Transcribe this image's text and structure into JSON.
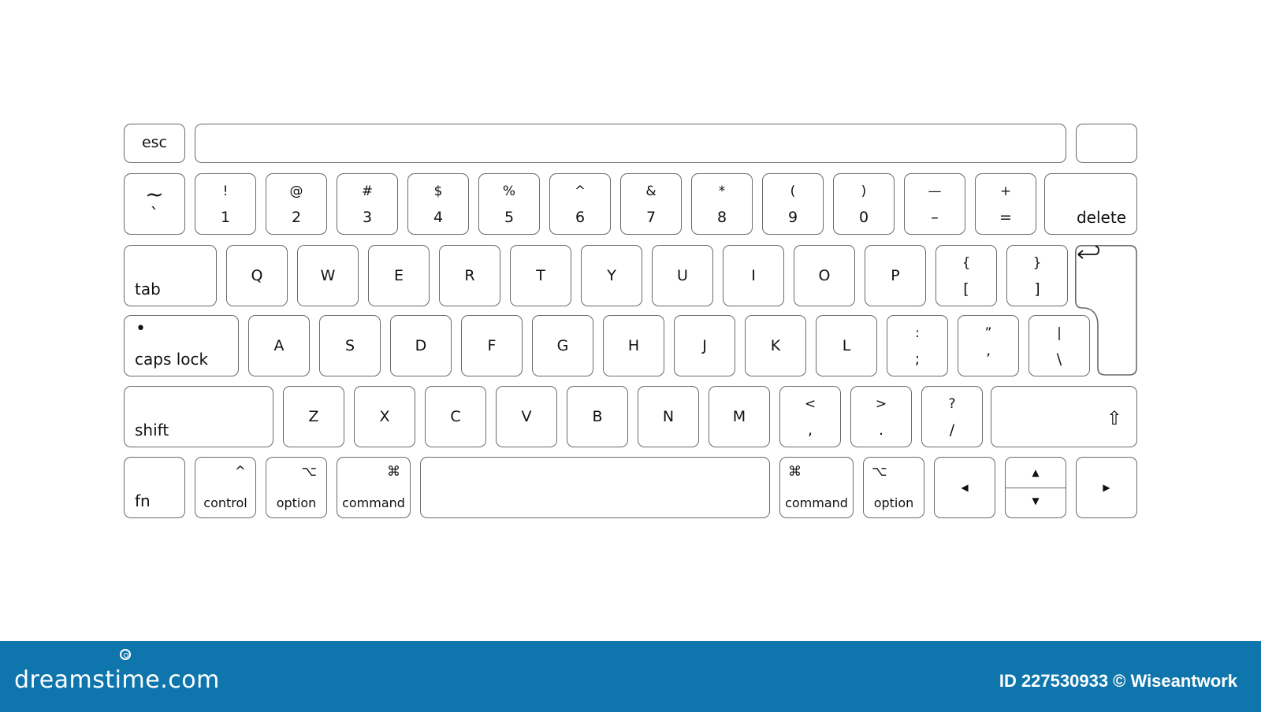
{
  "keyboard": {
    "row0": {
      "esc": "esc"
    },
    "row1": {
      "tilde_top": "~",
      "tilde_bottom": "`",
      "keys": [
        {
          "top": "!",
          "bottom": "1"
        },
        {
          "top": "@",
          "bottom": "2"
        },
        {
          "top": "#",
          "bottom": "3"
        },
        {
          "top": "$",
          "bottom": "4"
        },
        {
          "top": "%",
          "bottom": "5"
        },
        {
          "top": "^",
          "bottom": "6"
        },
        {
          "top": "&",
          "bottom": "7"
        },
        {
          "top": "*",
          "bottom": "8"
        },
        {
          "top": "(",
          "bottom": "9"
        },
        {
          "top": ")",
          "bottom": "0"
        },
        {
          "top": "—",
          "bottom": "–"
        },
        {
          "top": "+",
          "bottom": "="
        }
      ],
      "delete": "delete"
    },
    "row2": {
      "tab": "tab",
      "letters": [
        "Q",
        "W",
        "E",
        "R",
        "T",
        "Y",
        "U",
        "I",
        "O",
        "P"
      ],
      "brackets": [
        {
          "top": "{",
          "bottom": "["
        },
        {
          "top": "}",
          "bottom": "]"
        }
      ],
      "return_icon": "↵"
    },
    "row3": {
      "caps_dot": "•",
      "caps": "caps lock",
      "letters": [
        "A",
        "S",
        "D",
        "F",
        "G",
        "H",
        "J",
        "K",
        "L"
      ],
      "punct": [
        {
          "top": ":",
          "bottom": ";"
        },
        {
          "top": "”",
          "bottom": "’"
        },
        {
          "top": "|",
          "bottom": "\\"
        }
      ]
    },
    "row4": {
      "shift": "shift",
      "letters": [
        "Z",
        "X",
        "C",
        "V",
        "B",
        "N",
        "M"
      ],
      "punct": [
        {
          "top": "<",
          "bottom": ","
        },
        {
          "top": ">",
          "bottom": "."
        },
        {
          "top": "?",
          "bottom": "/"
        }
      ],
      "right_shift_icon": "⇧"
    },
    "row5": {
      "fn": "fn",
      "control": {
        "glyph": "^",
        "label": "control"
      },
      "option_left": {
        "glyph": "⌥",
        "label": "option"
      },
      "command_left": {
        "glyph": "⌘",
        "label": "command"
      },
      "command_right": {
        "glyph": "⌘",
        "label": "command"
      },
      "option_right": {
        "glyph": "⌥",
        "label": "option"
      },
      "arrow_left": "◀",
      "arrow_up": "▲",
      "arrow_down": "▼",
      "arrow_right": "▶"
    }
  },
  "footer": {
    "brand": "dreamstime.com",
    "credit": "ID 227530933 © Wiseantwork"
  }
}
